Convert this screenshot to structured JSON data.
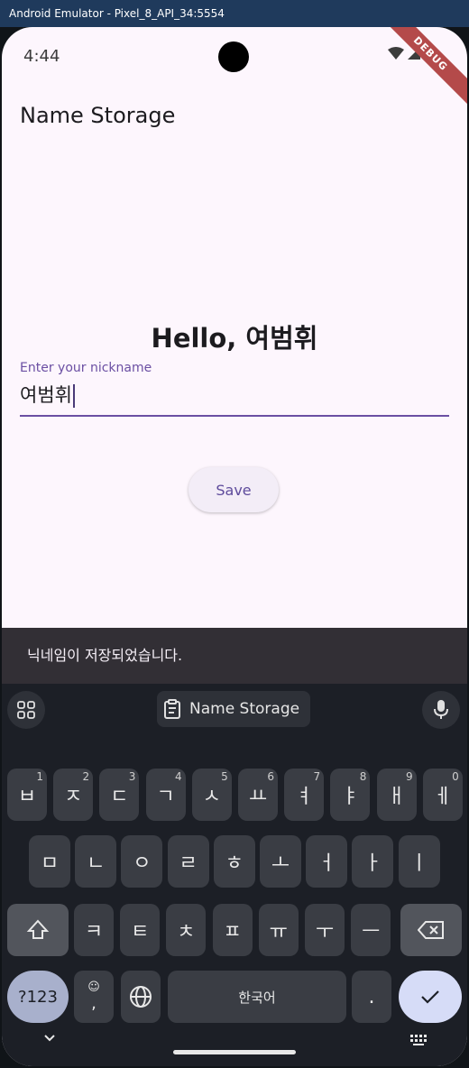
{
  "window": {
    "title": "Android Emulator - Pixel_8_API_34:5554"
  },
  "status_bar": {
    "time": "4:44",
    "debug_banner": "DEBUG"
  },
  "app": {
    "title": "Name Storage",
    "greeting": "Hello, 여범휘",
    "nickname_field": {
      "label": "Enter your nickname",
      "value": "여범휘"
    },
    "save_label": "Save"
  },
  "snackbar": {
    "message": "닉네임이 저장되었습니다."
  },
  "keyboard": {
    "suggestion": "Name Storage",
    "row1": [
      {
        "char": "ㅂ",
        "num": "1"
      },
      {
        "char": "ㅈ",
        "num": "2"
      },
      {
        "char": "ㄷ",
        "num": "3"
      },
      {
        "char": "ㄱ",
        "num": "4"
      },
      {
        "char": "ㅅ",
        "num": "5"
      },
      {
        "char": "ㅛ",
        "num": "6"
      },
      {
        "char": "ㅕ",
        "num": "7"
      },
      {
        "char": "ㅑ",
        "num": "8"
      },
      {
        "char": "ㅐ",
        "num": "9"
      },
      {
        "char": "ㅔ",
        "num": "0"
      }
    ],
    "row2": [
      "ㅁ",
      "ㄴ",
      "ㅇ",
      "ㄹ",
      "ㅎ",
      "ㅗ",
      "ㅓ",
      "ㅏ",
      "ㅣ"
    ],
    "row3": [
      "ㅋ",
      "ㅌ",
      "ㅊ",
      "ㅍ",
      "ㅠ",
      "ㅜ",
      "ㅡ"
    ],
    "symbols_label": "?123",
    "comma": ",",
    "space_label": "한국어",
    "period": "."
  },
  "colors": {
    "accent": "#6b4fa3",
    "background": "#fdf6fd",
    "keyboard": "#1c1f26"
  }
}
